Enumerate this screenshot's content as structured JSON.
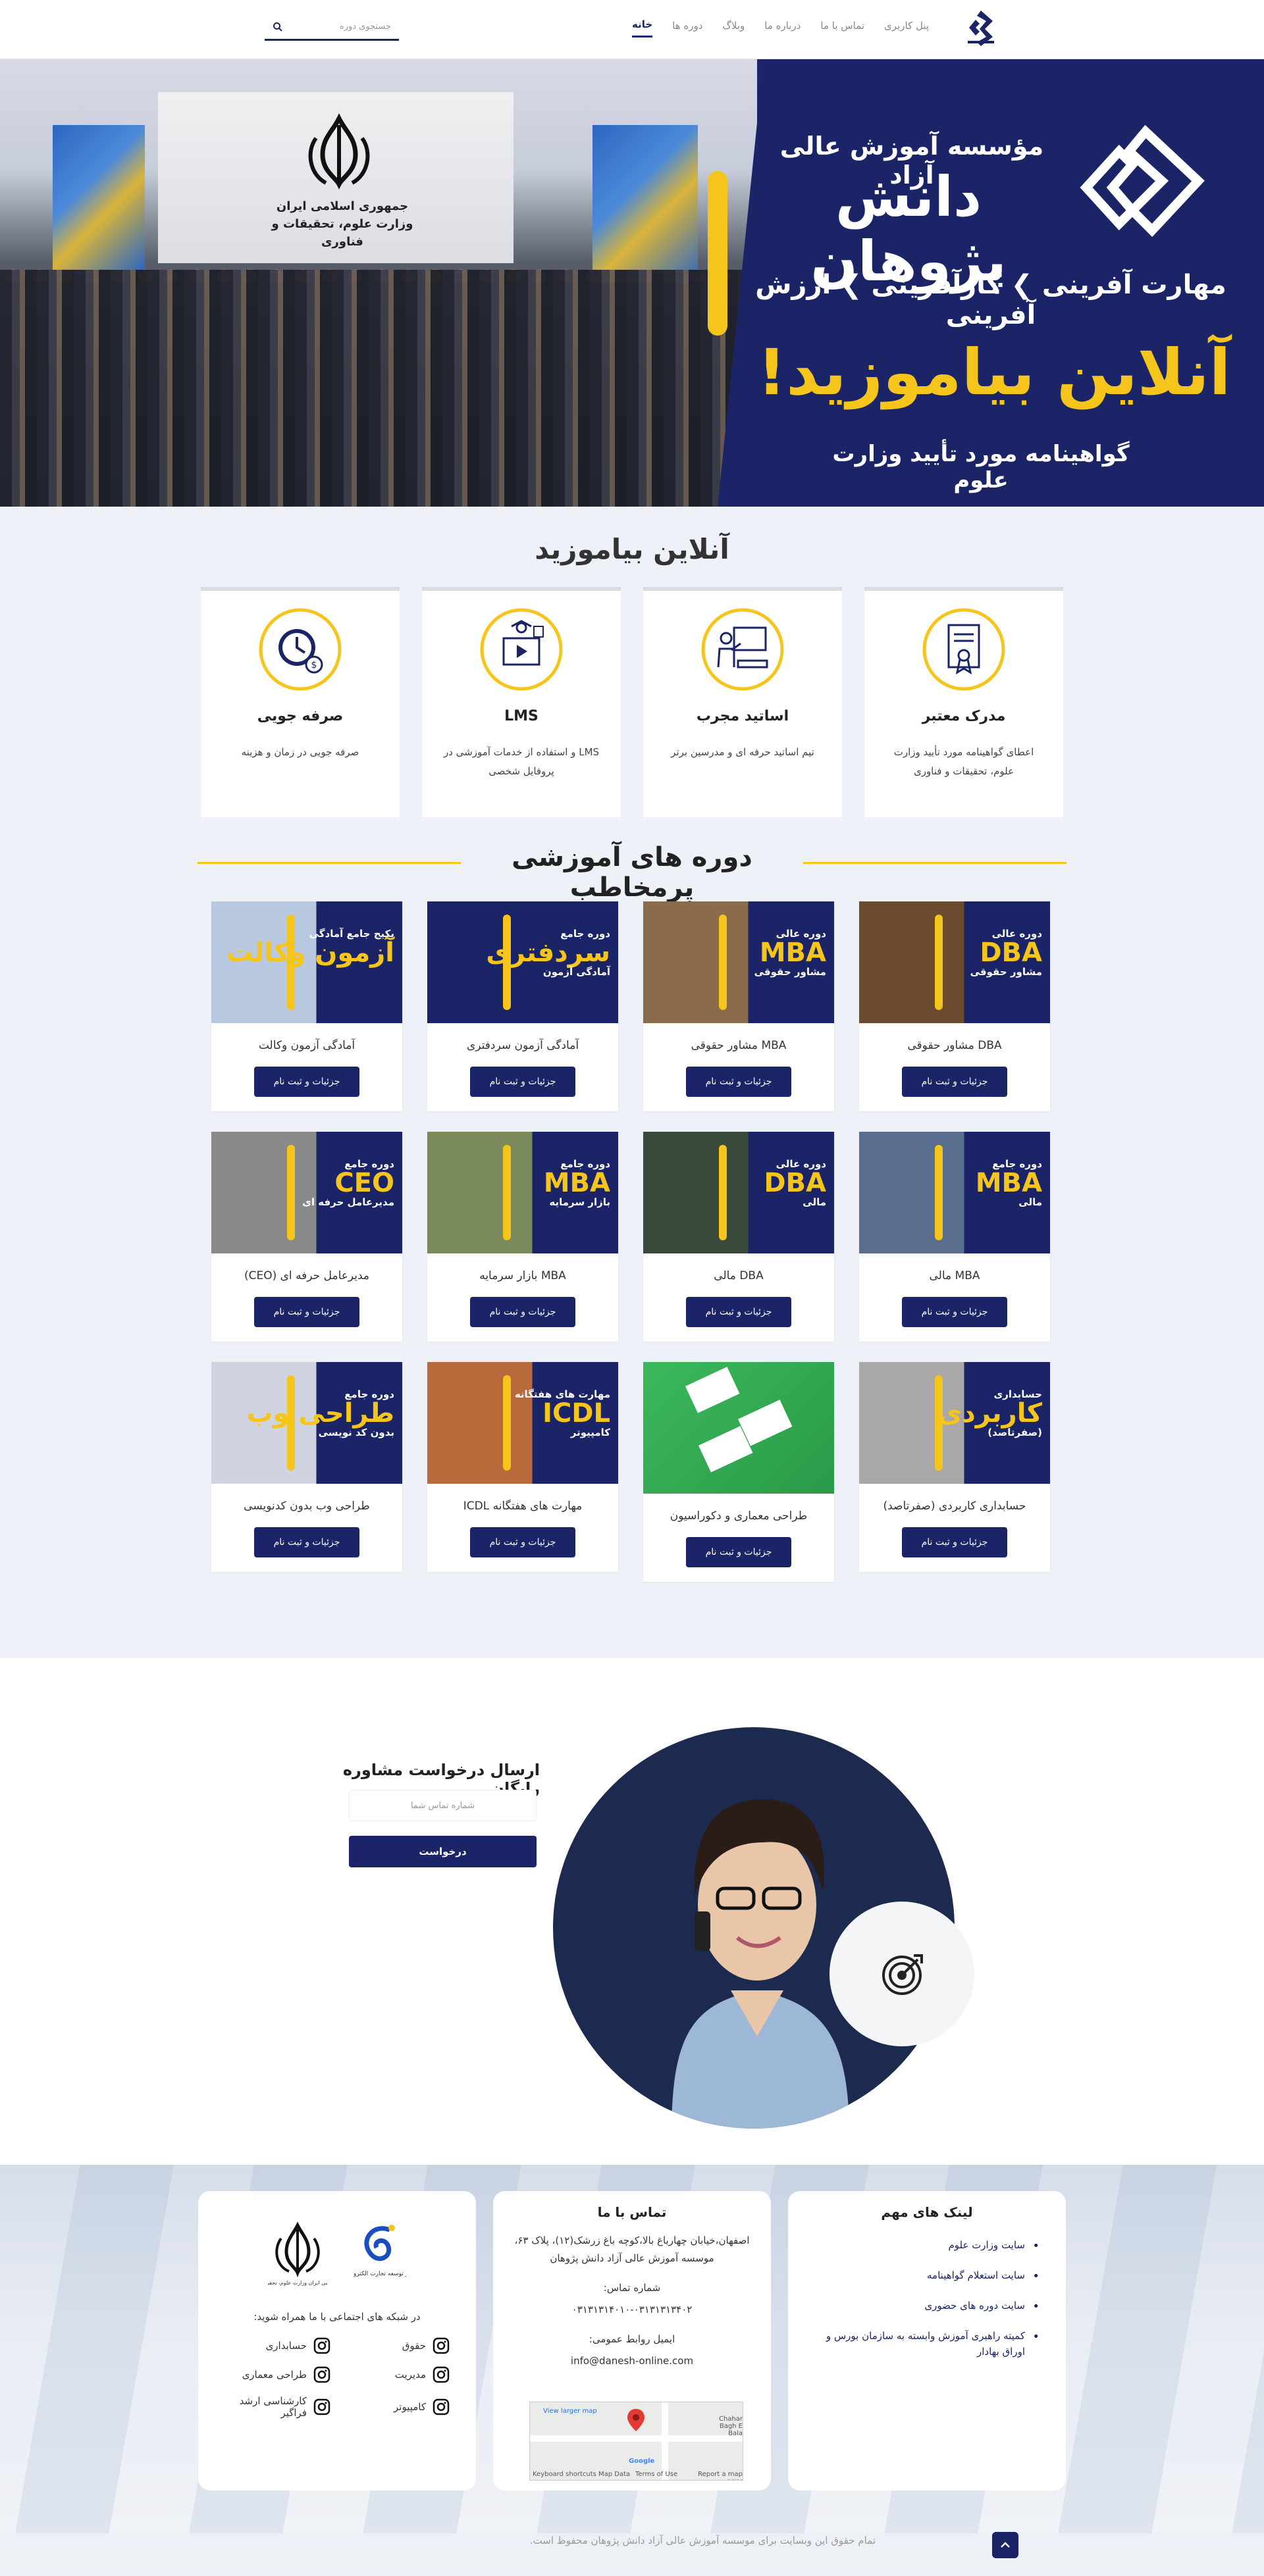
{
  "header": {
    "nav": [
      {
        "label": "خانه",
        "active": true
      },
      {
        "label": "دوره ها",
        "active": false
      },
      {
        "label": "وبلاگ",
        "active": false
      },
      {
        "label": "درباره ما",
        "active": false
      },
      {
        "label": "تماس با ما",
        "active": false
      },
      {
        "label": "پنل کاربری",
        "active": false
      }
    ],
    "search_placeholder": "جستجوی دوره"
  },
  "hero": {
    "emblem_line1": "جمهوری اسلامی ایران",
    "emblem_line2": "وزارت علوم، تحقیقات و فناوری",
    "institute": "مؤسسه آموزش عالی آزاد",
    "brand": "دانش پژوهان",
    "slogan": "مهارت آفرینی ❯ کارآفرینی ❯ ارزش آفرینی",
    "headline": "آنلاین بیاموزید!",
    "certificate": "گواهینامه مورد تأیید وزارت علوم"
  },
  "features": {
    "title": "آنلاین بیاموزید",
    "items": [
      {
        "icon": "certificate-icon",
        "title": "مدرک معتبر",
        "text": "اعطای گواهینامه مورد تأیید وزارت علوم، تحقیقات و فناوری"
      },
      {
        "icon": "teacher-icon",
        "title": "اساتید مجرب",
        "text": "تیم اساتید حرفه ای و مدرسین برتر"
      },
      {
        "icon": "lms-icon",
        "title": "LMS",
        "text": "LMS و استفاده از خدمات آموزشی در پروفایل شخصی"
      },
      {
        "icon": "time-saving-icon",
        "title": "صرفه جویی",
        "text": "صرفه جویی در زمان و هزینه"
      }
    ]
  },
  "courses": {
    "title": "دوره های آموزشی پرمخاطب",
    "button_label": "جزئیات و ثبت نام",
    "items": [
      {
        "title": "DBA مشاور حقوقی",
        "big": "DBA",
        "sm1": "دوره عالی",
        "sm2": "مشاور حقوقی",
        "bg": "#1a2466",
        "photo": "#6b4a2e"
      },
      {
        "title": "MBA مشاور حقوقی",
        "big": "MBA",
        "sm1": "دوره عالی",
        "sm2": "مشاور حقوقی",
        "bg": "#1a2466",
        "photo": "#8a6b4a"
      },
      {
        "title": "آمادگی آزمون سردفتری",
        "big": "سردفتری",
        "sm1": "دوره جامع",
        "sm2": "آمادگی آزمون",
        "bg": "#1a2466",
        "photo": "#1a2466"
      },
      {
        "title": "آمادگی آزمون وکالت",
        "big": "آزمون وکالت",
        "sm1": "پکیج جامع آمادگی",
        "sm2": "",
        "bg": "#1a2466",
        "photo": "#b8c8e0"
      },
      {
        "title": "MBA مالی",
        "big": "MBA",
        "sm1": "دوره جامع",
        "sm2": "مالی",
        "bg": "#1a2466",
        "photo": "#5a6f8f"
      },
      {
        "title": "DBA مالی",
        "big": "DBA",
        "sm1": "دوره عالی",
        "sm2": "مالی",
        "bg": "#1a2466",
        "photo": "#3a4a3a"
      },
      {
        "title": "MBA بازار سرمایه",
        "big": "MBA",
        "sm1": "دوره جامع",
        "sm2": "بازار سرمایه",
        "bg": "#1a2466",
        "photo": "#7a8a5a"
      },
      {
        "title": "مدیرعامل حرفه ای (CEO)",
        "big": "CEO",
        "sm1": "دوره جامع",
        "sm2": "مدیرعامل حرفه ای",
        "bg": "#1a2466",
        "photo": "#8a8a8a"
      },
      {
        "title": "حسابداری کاربردی (صفرتاصد)",
        "big": "کاربردی",
        "sm1": "حسابداری",
        "sm2": "(صفرتاصد)",
        "bg": "#1a2466",
        "photo": "#a8a8a8"
      },
      {
        "title": "طراحی معماری و دکوراسیون",
        "big": "",
        "sm1": "",
        "sm2": "",
        "bg": "#2fa84f",
        "photo": "#2fa84f"
      },
      {
        "title": "مهارت های هفتگانه ICDL",
        "big": "ICDL",
        "sm1": "مهارت های هفتگانه",
        "sm2": "کامپیوتر",
        "bg": "#1a2466",
        "photo": "#b86a3a"
      },
      {
        "title": "طراحی وب بدون کدنویسی",
        "big": "طراحی وب",
        "sm1": "دوره جامع",
        "sm2": "بدون کد نویسی",
        "bg": "#1a2466",
        "photo": "#d0d4e0"
      }
    ]
  },
  "consult": {
    "title": "ارسال درخواست مشاوره رایگان",
    "phone_placeholder": "شماره تماس شما",
    "submit_label": "درخواست"
  },
  "footer": {
    "links_title": "لینک های مهم",
    "links": [
      "سایت وزارت علوم",
      "سایت استعلام گواهینامه",
      "سایت دوره های حضوری",
      "کمیته راهبری آموزش وابسته به سازمان بورس و اوراق بهادار"
    ],
    "contact_title": "تماس با ما",
    "address": "اصفهان،خیابان چهارباغ بالا،کوچه باغ زرشک(۱۲)، پلاک ۶۳، موسسه آموزش عالی آزاد دانش پژوهان",
    "phone_label": "شماره تماس:",
    "phones": "۰۳۱۳۱۳۱۴۰۱۰-۰۳۱۳۱۳۱۳۴۰۲",
    "email_label": "ایمیل روابط عمومی:",
    "email": "info@danesh-online.com",
    "map": {
      "larger": "View larger map",
      "shortcuts": "Keyboard shortcuts",
      "data": "Map Data",
      "terms": "Terms of Use",
      "report": "Report a map error",
      "google": "Google",
      "street": "Chahar Bagh E Bala"
    },
    "social_title": "در شبکه های اجتماعی با ما همراه شوید:",
    "social": [
      "حقوق",
      "حسابداری",
      "مدیریت",
      "طراحی معماری",
      "کامپیوتر",
      "کارشناسی ارشد فراگیر"
    ],
    "emblem_caption": "جمهوری اسلامی ایران وزارت علوم، تحقیقات و فناوری",
    "enamad_caption": "مرکز توسعه تجارت الکترونیکی",
    "copyright": "تمام حقوق این وبسایت برای موسسه آموزش عالی آزاد دانش پژوهان محفوظ است."
  },
  "colors": {
    "primary": "#1a2466",
    "accent": "#f6c51b",
    "bg": "#eef1f7"
  }
}
